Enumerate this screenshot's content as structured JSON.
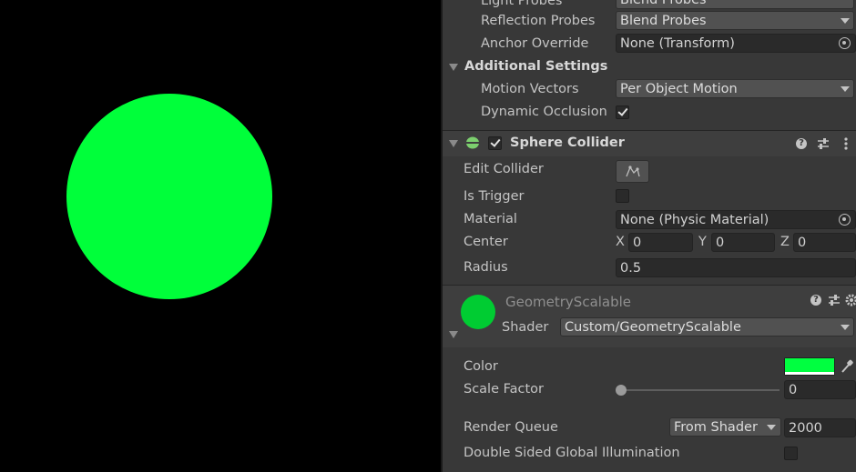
{
  "colors": {
    "sphere": "#00ff3a",
    "material_preview": "#00cc32",
    "color_swatch": "#00ff40"
  },
  "mesh_renderer": {
    "light_probes_label": "Light Probes",
    "light_probes_value": "Blend Probes",
    "reflection_probes_label": "Reflection Probes",
    "reflection_probes_value": "Blend Probes",
    "anchor_override_label": "Anchor Override",
    "anchor_override_value": "None (Transform)",
    "additional_settings_label": "Additional Settings",
    "motion_vectors_label": "Motion Vectors",
    "motion_vectors_value": "Per Object Motion",
    "dynamic_occlusion_label": "Dynamic Occlusion",
    "dynamic_occlusion_checked": true
  },
  "sphere_collider": {
    "title": "Sphere Collider",
    "enabled": true,
    "edit_collider_label": "Edit Collider",
    "is_trigger_label": "Is Trigger",
    "is_trigger_checked": false,
    "material_label": "Material",
    "material_value": "None (Physic Material)",
    "center_label": "Center",
    "center_x_label": "X",
    "center_x": "0",
    "center_y_label": "Y",
    "center_y": "0",
    "center_z_label": "Z",
    "center_z": "0",
    "radius_label": "Radius",
    "radius_value": "0.5"
  },
  "material": {
    "name": "GeometryScalable",
    "shader_label": "Shader",
    "shader_value": "Custom/GeometryScalable",
    "color_label": "Color",
    "scale_factor_label": "Scale Factor",
    "scale_factor_value": "0",
    "scale_factor_fraction": 0,
    "render_queue_label": "Render Queue",
    "render_queue_mode": "From Shader",
    "render_queue_value": "2000",
    "double_sided_gi_label": "Double Sided Global Illumination",
    "double_sided_gi_checked": false
  }
}
